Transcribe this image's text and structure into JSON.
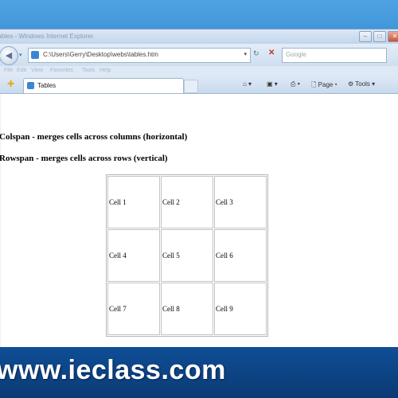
{
  "window": {
    "title": "tables - Windows Internet Explorer",
    "controls": [
      "minimize",
      "maximize",
      "close"
    ]
  },
  "addressbar": {
    "url": "C:\\Users\\Gerry\\Desktop\\webs\\tables.htm",
    "search_placeholder": "Google"
  },
  "menubar": {
    "items": [
      "File",
      "Edit",
      "View",
      "Favorites",
      "Tools",
      "Help"
    ]
  },
  "tabbar": {
    "tab_label": "Tables",
    "home_icon": "home-icon",
    "feeds_icon": "feeds-icon",
    "print_icon": "print-icon",
    "page_label": "Page",
    "tools_label": "Tools"
  },
  "page": {
    "heading1": "Colspan - merges cells across columns (horizontal)",
    "heading2": "Rowspan - merges cells across rows (vertical)",
    "table": {
      "rows": [
        [
          "Cell 1",
          "Cell 2",
          "Cell 3"
        ],
        [
          "Cell 4",
          "Cell 5",
          "Cell 6"
        ],
        [
          "Cell 7",
          "Cell 8",
          "Cell 9"
        ]
      ]
    }
  },
  "watermark": {
    "text": "www.ieclass.com"
  },
  "colors": {
    "desktop": "#1a5fa8",
    "watermark_bg": "#0f4e96"
  }
}
